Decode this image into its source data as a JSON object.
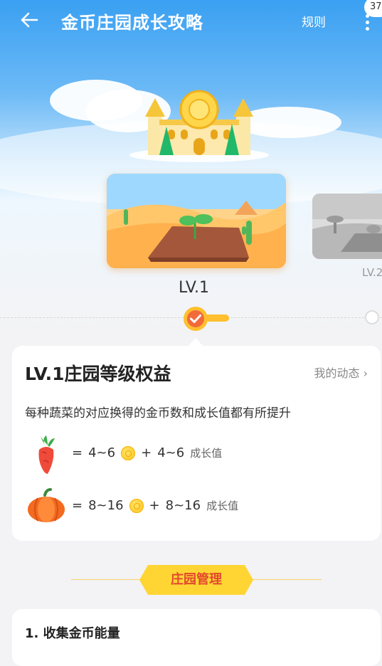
{
  "header": {
    "title": "金币庄园成长攻略",
    "rules_label": "规则",
    "badge_count": "37"
  },
  "levels": [
    {
      "label": "LV.1",
      "state": "current"
    },
    {
      "label": "LV.2",
      "state": "locked"
    }
  ],
  "benefits": {
    "title": "LV.1庄园等级权益",
    "link_label": "我的动态 ›",
    "description": "每种蔬菜的对应换得的金币数和成长值都有所提升",
    "rows": [
      {
        "icon": "carrot-icon",
        "eq": "=",
        "coins": "4~6",
        "plus": "+",
        "growth": "4~6",
        "growth_label": "成长值"
      },
      {
        "icon": "pumpkin-icon",
        "eq": "=",
        "coins": "8~16",
        "plus": "+",
        "growth": "8~16",
        "growth_label": "成长值"
      }
    ]
  },
  "section": {
    "title": "庄园管理"
  },
  "management": {
    "item1": "1. 收集金币能量"
  },
  "colors": {
    "accent": "#ffbf2e",
    "sky": "#3aa0f2",
    "section_text": "#e2492c"
  }
}
